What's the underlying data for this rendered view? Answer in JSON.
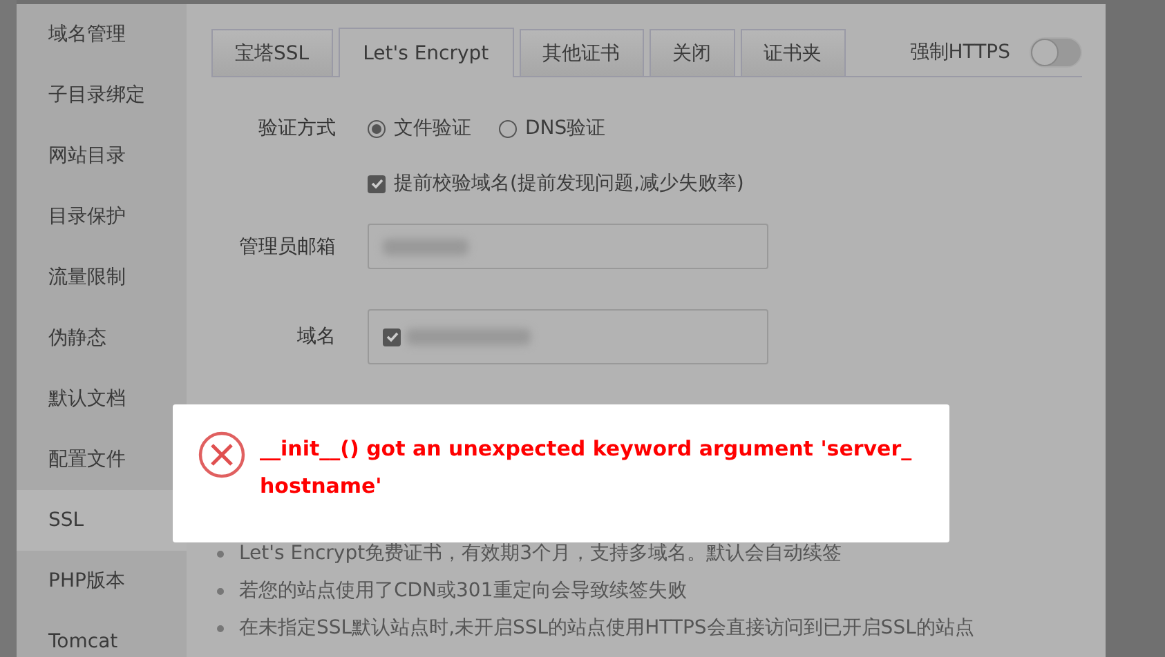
{
  "sidebar": {
    "items": [
      {
        "label": "域名管理",
        "selected": false
      },
      {
        "label": "子目录绑定",
        "selected": false
      },
      {
        "label": "网站目录",
        "selected": false
      },
      {
        "label": "目录保护",
        "selected": false
      },
      {
        "label": "流量限制",
        "selected": false
      },
      {
        "label": "伪静态",
        "selected": false
      },
      {
        "label": "默认文档",
        "selected": false
      },
      {
        "label": "配置文件",
        "selected": false
      },
      {
        "label": "SSL",
        "selected": true
      },
      {
        "label": "PHP版本",
        "selected": false
      },
      {
        "label": "Tomcat",
        "selected": false
      }
    ]
  },
  "tabs": [
    {
      "label": "宝塔SSL",
      "selected": false
    },
    {
      "label": "Let's Encrypt",
      "selected": true
    },
    {
      "label": "其他证书",
      "selected": false
    },
    {
      "label": "关闭",
      "selected": false
    },
    {
      "label": "证书夹",
      "selected": false
    }
  ],
  "force_https": {
    "label": "强制HTTPS",
    "on": false
  },
  "form": {
    "verify_label": "验证方式",
    "verify_options": [
      {
        "label": "文件验证",
        "selected": true
      },
      {
        "label": "DNS验证",
        "selected": false
      }
    ],
    "precheck": {
      "label": "提前校验域名(提前发现问题,减少失败率)",
      "checked": true
    },
    "email_label": "管理员邮箱",
    "domain_label": "域名",
    "domain_checked": true
  },
  "notes": [
    "Let's Encrypt免费证书，有效期3个月，支持多域名。默认会自动续签",
    "若您的站点使用了CDN或301重定向会导致续签失败",
    "在未指定SSL默认站点时,未开启SSL的站点使用HTTPS会直接访问到已开启SSL的站点"
  ],
  "toast": {
    "kind": "error",
    "message": "__init__() got an unexpected keyword argument 'server_hostname'"
  }
}
